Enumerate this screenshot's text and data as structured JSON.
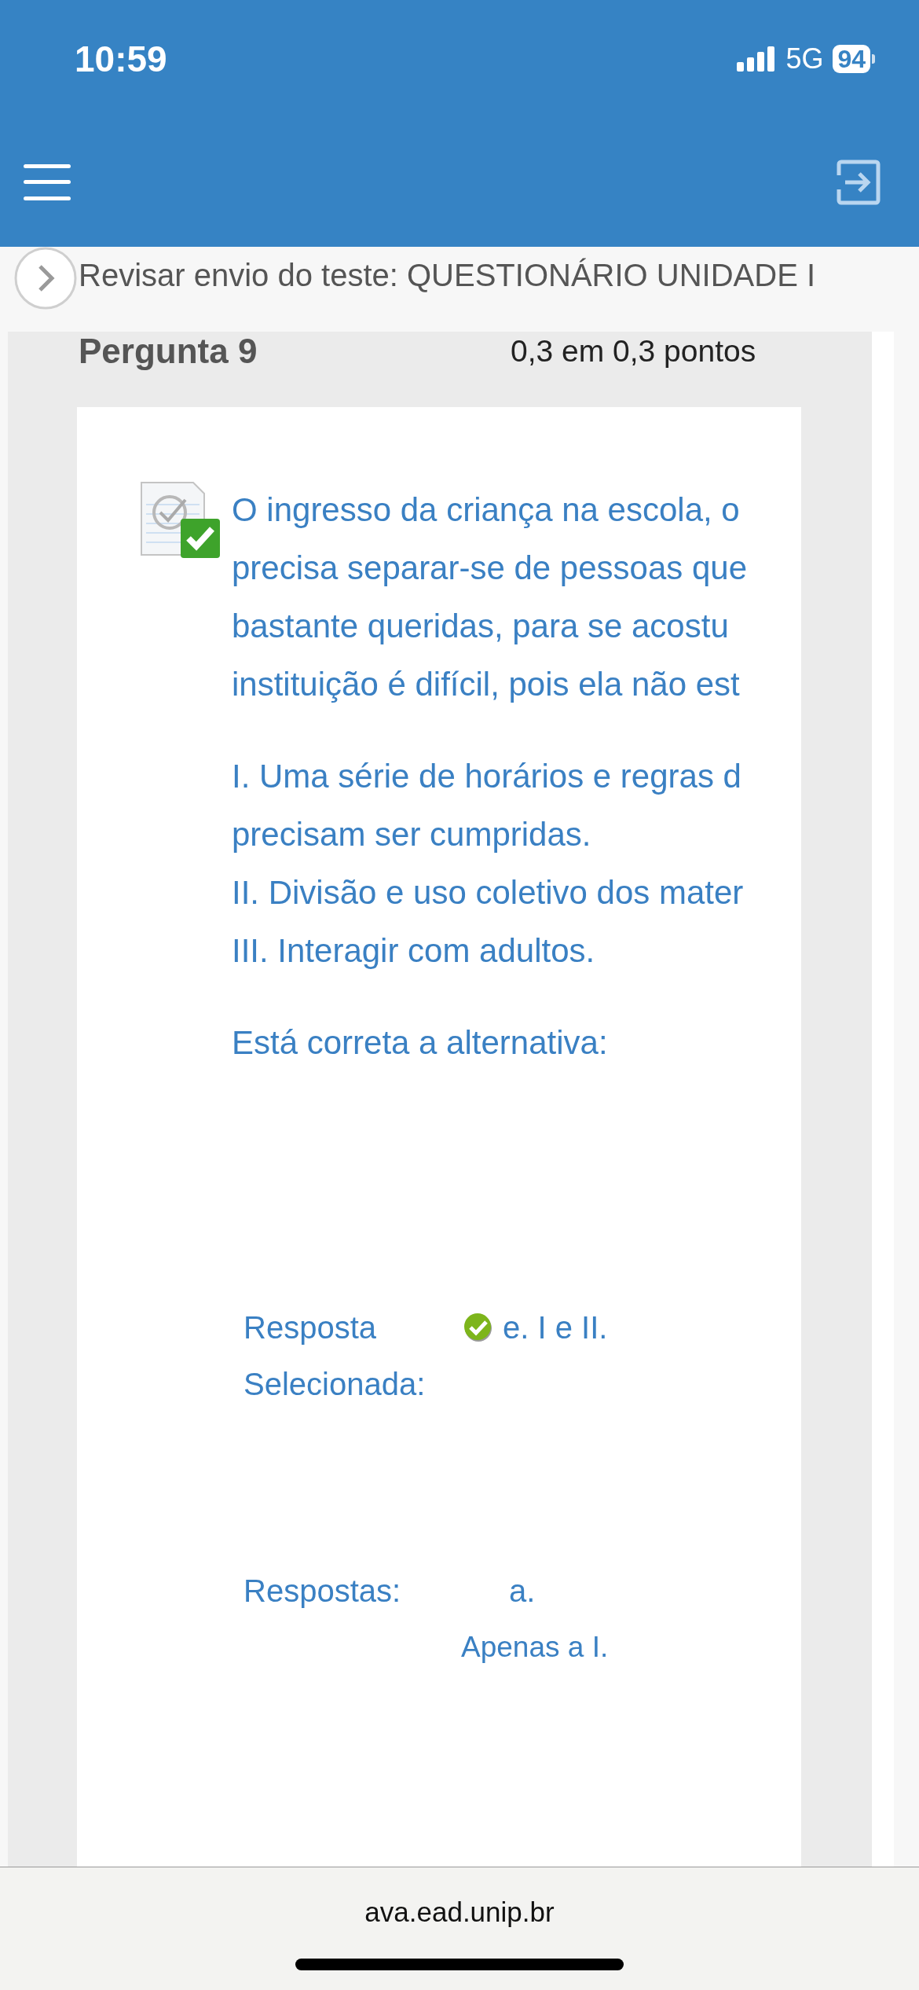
{
  "status_bar": {
    "time": "10:59",
    "network": "5G",
    "battery": "94"
  },
  "breadcrumb": {
    "title": "Revisar envio do teste: QUESTIONÁRIO UNIDADE I"
  },
  "question": {
    "title": "Pergunta 9",
    "score": "0,3 em 0,3 pontos",
    "correct": true,
    "text_lines": [
      "O ingresso da criança na escola, o",
      "precisa separar-se de pessoas que",
      "bastante queridas, para se acostu",
      "instituição é difícil, pois ela não est"
    ],
    "statements": [
      "I. Uma série de horários e regras d",
      "precisam ser cumpridas.",
      "II. Divisão e uso coletivo dos mater",
      "III. Interagir com adultos."
    ],
    "prompt": "Está correta a alternativa:"
  },
  "selected_answer": {
    "label": "Resposta Selecionada:",
    "correct": true,
    "text": "e. I e II."
  },
  "answers": {
    "label": "Respostas:",
    "letter": "a.",
    "text": "Apenas a I."
  },
  "browser": {
    "url": "ava.ead.unip.br"
  }
}
